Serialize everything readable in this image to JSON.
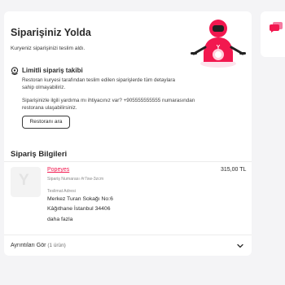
{
  "status": {
    "title": "Siparişiniz Yolda",
    "subtitle": "Kuryeniz siparişinizi teslim aldı.",
    "tracking_title": "Limitli sipariş takibi",
    "tracking_desc": "Restoran kuryesi tarafından teslim edilen siparişlerde tüm detaylara sahip olmayabiliriz.",
    "help_text": "Siparişinizle ilgili yardıma mı ihtiyacınız var? +905555555555 numarasından restorana ulaşabilirsiniz.",
    "call_button": "Restoranı ara"
  },
  "order": {
    "title": "Sipariş Bilgileri",
    "restaurant": "Popeyes",
    "order_number": "Sipariş Numarası #r7sw-3zcm",
    "price": "315,00 TL",
    "address_label": "Teslimat Adresi",
    "address_line1": "Merkez Turan Sokağı No:6",
    "address_line2": "Kâğıthane İstanbul 34406",
    "more": "daha fazla",
    "thumb_letter": "Y"
  },
  "details": {
    "label": "Ayrıntıları Gör",
    "count": "(1 ürün)"
  },
  "colors": {
    "brand": "#f2184f",
    "background": "#f4f4f6"
  },
  "icons": {
    "chat": "chat-bubble-icon",
    "tracking": "location-pin-icon",
    "expand": "chevron-down-icon"
  }
}
